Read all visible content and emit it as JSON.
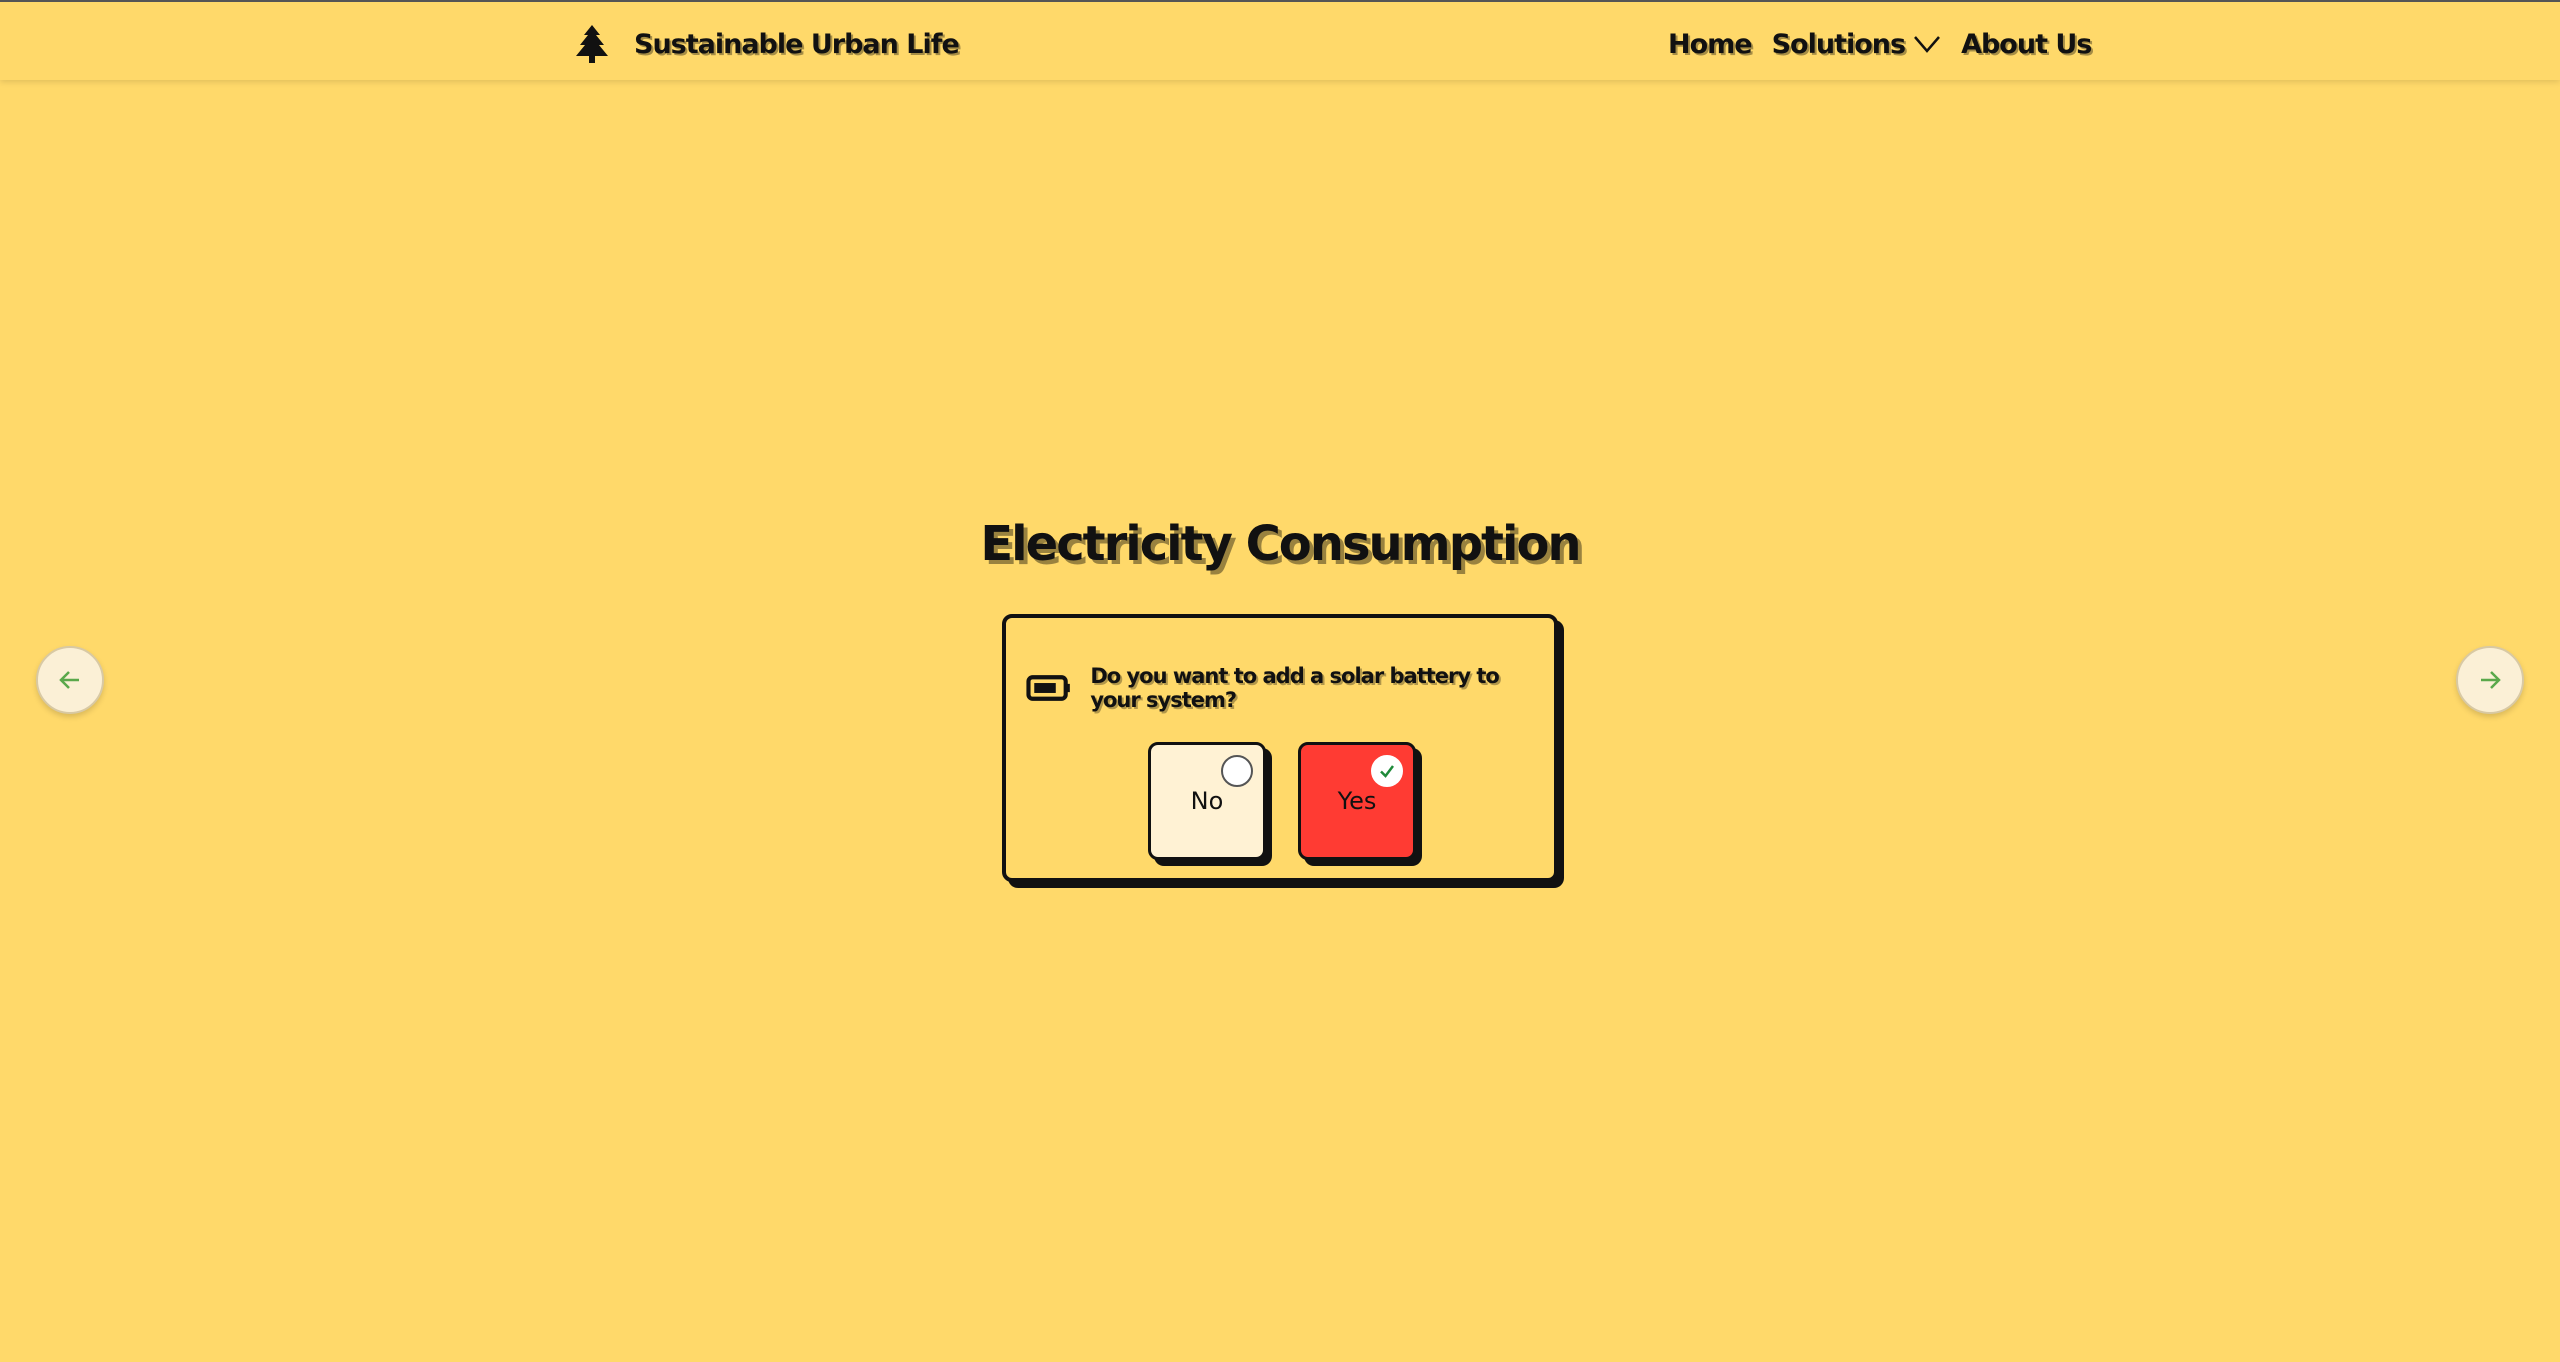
{
  "header": {
    "brand": "Sustainable Urban Life",
    "nav": {
      "home": "Home",
      "solutions": "Solutions",
      "about": "About Us"
    }
  },
  "main": {
    "title": "Electricity Consumption",
    "question": "Do you want to add a solar battery to your system?",
    "options": [
      {
        "label": "No",
        "selected": false
      },
      {
        "label": "Yes",
        "selected": true
      }
    ]
  },
  "colors": {
    "background": "#ffd96a",
    "selected_option": "#ff3b33",
    "unselected_option": "#fff2d4",
    "arrow_accent": "#5aa84a",
    "check_accent": "#1f8a3a"
  },
  "icons": {
    "brand": "tree-icon",
    "solutions_caret": "chevron-down-icon",
    "question": "battery-icon",
    "prev": "arrow-left-icon",
    "next": "arrow-right-icon"
  }
}
